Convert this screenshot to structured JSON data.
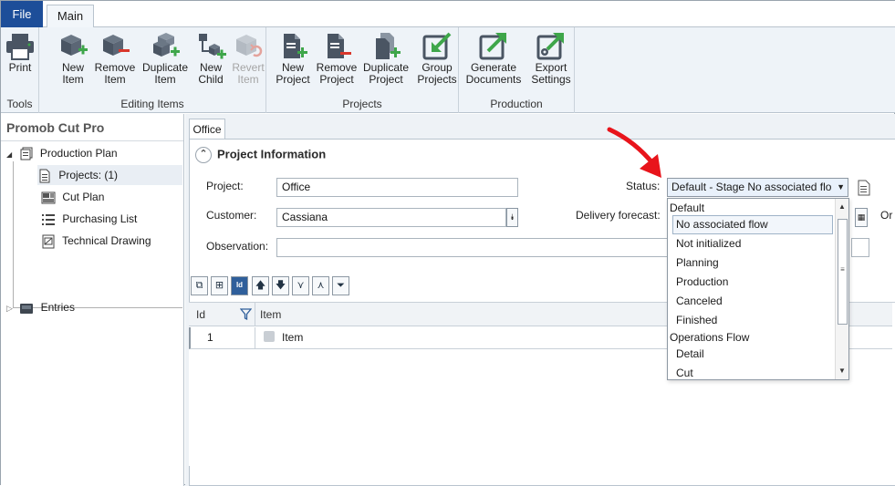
{
  "tabs": {
    "file": "File",
    "main": "Main"
  },
  "ribbon": {
    "groups": {
      "tools": "Tools",
      "editing": "Editing Items",
      "projects": "Projects",
      "production": "Production"
    },
    "buttons": {
      "print": "Print",
      "new_item": [
        "New",
        "Item"
      ],
      "remove_item": [
        "Remove",
        "Item"
      ],
      "duplicate_item": [
        "Duplicate",
        "Item"
      ],
      "new_child": [
        "New",
        "Child"
      ],
      "revert_item": [
        "Revert",
        "Item"
      ],
      "new_project": [
        "New",
        "Project"
      ],
      "remove_project": [
        "Remove",
        "Project"
      ],
      "duplicate_project": [
        "Duplicate",
        "Project"
      ],
      "group_projects": [
        "Group",
        "Projects"
      ],
      "generate_documents": [
        "Generate",
        "Documents"
      ],
      "export_settings": [
        "Export",
        "Settings"
      ]
    }
  },
  "sidebar": {
    "title": "Promob Cut Pro",
    "tree": {
      "production_plan": "Production Plan",
      "projects": "Projects: (1)",
      "cut_plan": "Cut Plan",
      "purchasing_list": "Purchasing List",
      "technical_drawing": "Technical Drawing",
      "entries": "Entries"
    }
  },
  "document": {
    "tab": "Office",
    "section_title": "Project Information",
    "labels": {
      "project": "Project:",
      "customer": "Customer:",
      "observation": "Observation:",
      "status": "Status:",
      "delivery": "Delivery forecast:",
      "order_partial": "Or"
    },
    "values": {
      "project": "Office",
      "customer": "Cassiana",
      "observation": "",
      "status": "Default - Stage No associated flo"
    }
  },
  "grid": {
    "columns": {
      "id": "Id",
      "item": "Item"
    },
    "rows": [
      {
        "id": "1",
        "item": "Item"
      }
    ],
    "toolbar": {
      "id_button": "Id"
    }
  },
  "status_dropdown": {
    "group1": "Default",
    "group1_items": [
      "No associated flow",
      "Not initialized",
      "Planning",
      "Production",
      "Canceled",
      "Finished"
    ],
    "group2": "Operations Flow",
    "group2_items": [
      "Detail",
      "Cut"
    ]
  },
  "colors": {
    "file_tab": "#1d4e99",
    "ribbon_bg": "#eef3f8",
    "arrow_annotation": "#e8141b",
    "icon_dark": "#4a5563",
    "icon_green": "#3ea64a"
  }
}
